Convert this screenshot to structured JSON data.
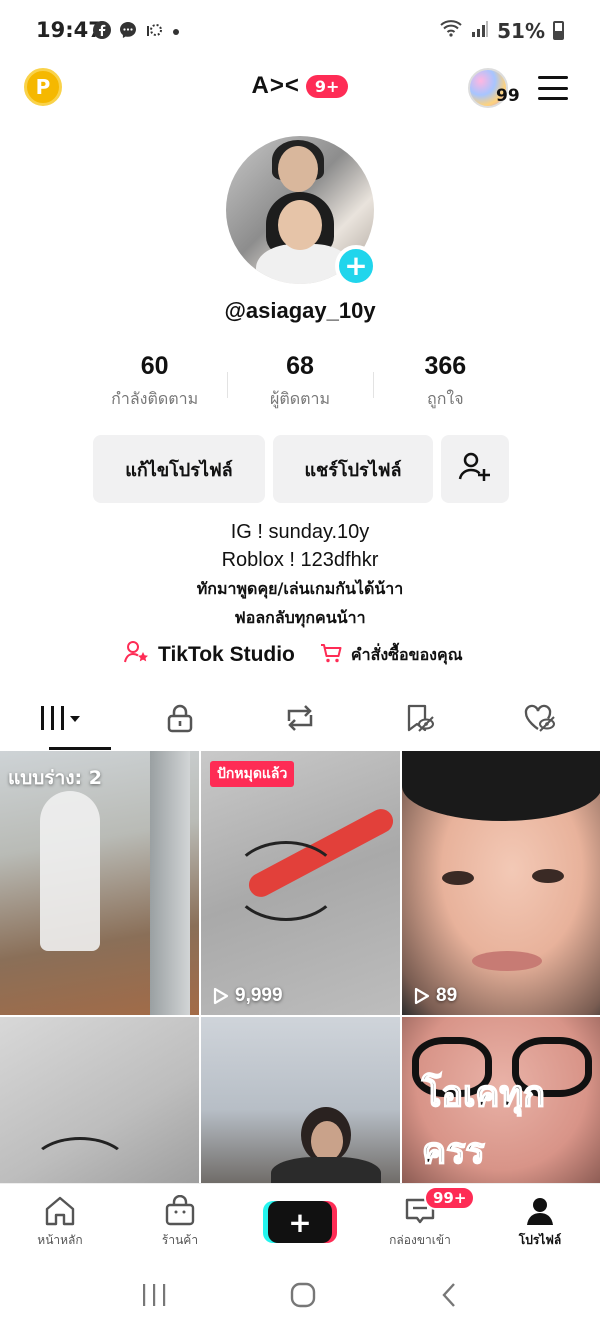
{
  "status_bar": {
    "time": "19:47",
    "battery": "51%"
  },
  "header": {
    "coin_label": "P",
    "title": "A><",
    "title_badge": "9+",
    "story_count": "99"
  },
  "profile": {
    "username": "@asiagay_10y",
    "stats": [
      {
        "value": "60",
        "label": "กำลังติดตาม"
      },
      {
        "value": "68",
        "label": "ผู้ติดตาม"
      },
      {
        "value": "366",
        "label": "ถูกใจ"
      }
    ],
    "edit_button": "แก้ไขโปรไฟล์",
    "share_button": "แชร์โปรไฟล์",
    "bio": [
      "IG ! sunday.10y",
      "Roblox ! 123dfhkr",
      "ทักมาพูดคุย/เล่นเกมกันได้น้าา",
      "ฟอลกลับทุกคนน้าา"
    ],
    "links": {
      "studio": "TikTok Studio",
      "orders": "คำสั่งซื้อของคุณ"
    }
  },
  "videos": [
    {
      "draft_label": "แบบร่าง: 2"
    },
    {
      "pinned_label": "ปักหมุดแล้ว",
      "views": "9,999"
    },
    {
      "views": "89"
    },
    {},
    {},
    {
      "overlay_text": "โอเคทุกครร"
    }
  ],
  "bottom_nav": {
    "home": "หน้าหลัก",
    "shop": "ร้านค้า",
    "create": "+",
    "inbox": "กล่องขาเข้า",
    "inbox_badge": "99+",
    "profile": "โปรไฟล์"
  },
  "colors": {
    "accent": "#fe2c55",
    "cyan": "#20d5ec",
    "coin": "#f5b800"
  }
}
